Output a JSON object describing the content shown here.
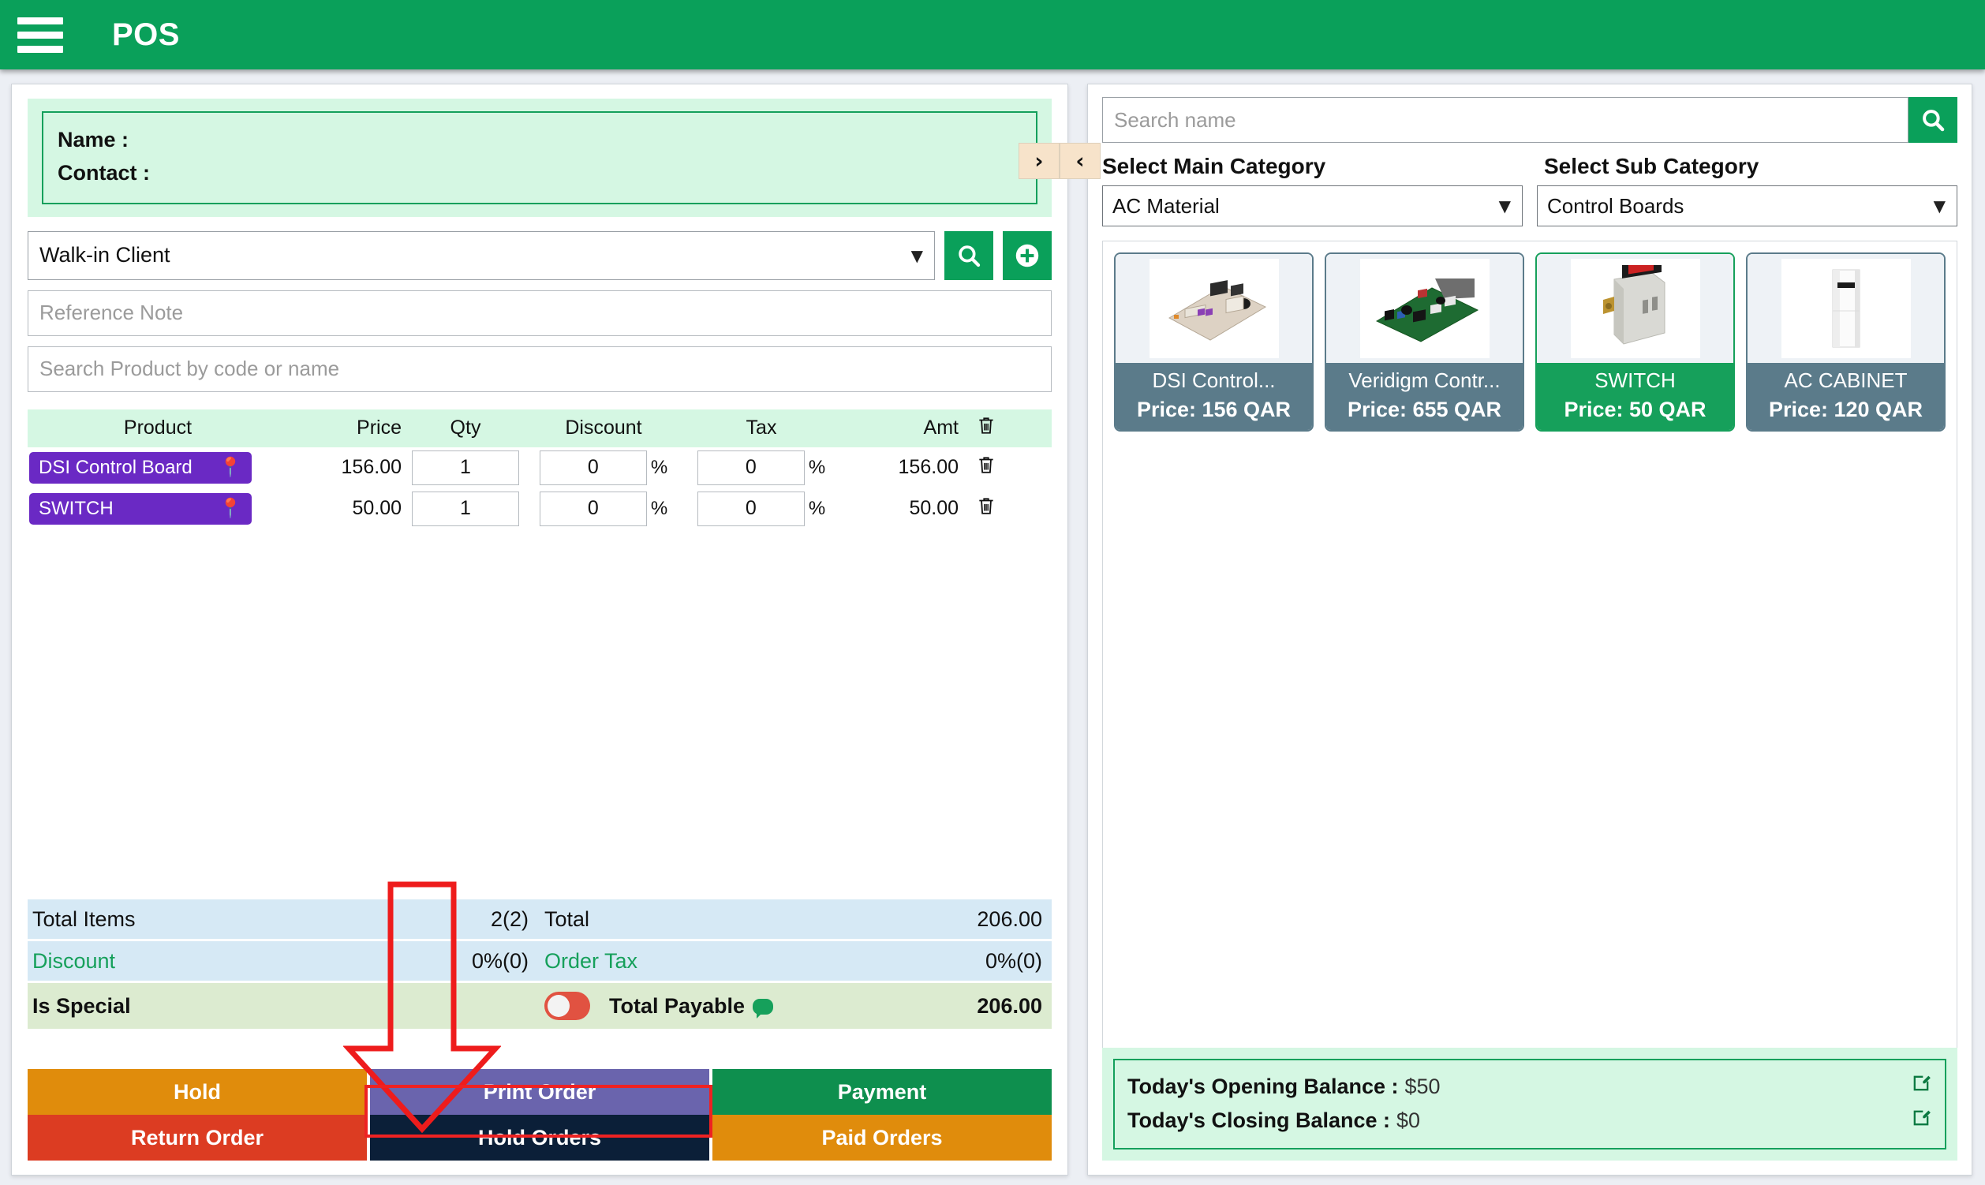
{
  "topbar": {
    "menu_icon": "hamburger-icon",
    "title": "POS"
  },
  "toggles": {
    "right": "›",
    "left": "‹"
  },
  "customer": {
    "name_label": "Name :",
    "contact_label": "Contact :"
  },
  "client": {
    "selected": "Walk-in Client",
    "caret": "▼",
    "search_icon": "search-icon",
    "add_icon": "plus-icon"
  },
  "inputs": {
    "reference_note_placeholder": "Reference Note",
    "product_search_placeholder": "Search Product by code or name"
  },
  "items_table": {
    "headers": [
      "Product",
      "Price",
      "Qty",
      "Discount",
      "Tax",
      "Amt"
    ],
    "delete_all_icon": "trash-icon",
    "percent_symbol": "%",
    "rows": [
      {
        "product": "DSI Control Board",
        "pin_icon": "location-pin-icon",
        "price": "156.00",
        "qty": "1",
        "discount": "0",
        "tax": "0",
        "amount": "156.00",
        "delete_icon": "trash-icon"
      },
      {
        "product": "SWITCH",
        "pin_icon": "location-pin-icon",
        "price": "50.00",
        "qty": "1",
        "discount": "0",
        "tax": "0",
        "amount": "50.00",
        "delete_icon": "trash-icon"
      }
    ]
  },
  "totals": {
    "total_items_label": "Total Items",
    "total_items_value": "2(2)",
    "total_label": "Total",
    "total_value": "206.00",
    "discount_label": "Discount",
    "discount_value": "0%(0)",
    "order_tax_label": "Order Tax",
    "order_tax_value": "0%(0)",
    "is_special_label": "Is Special",
    "total_payable_label": "Total Payable",
    "total_payable_value": "206.00"
  },
  "actions": {
    "hold": "Hold",
    "print_order": "Print Order",
    "payment": "Payment",
    "return_order": "Return Order",
    "hold_orders": "Hold Orders",
    "paid_orders": "Paid Orders"
  },
  "right": {
    "search_placeholder": "Search name",
    "search_icon": "search-icon",
    "main_category_label": "Select Main Category",
    "main_category_value": "AC Material",
    "sub_category_label": "Select Sub Category",
    "sub_category_value": "Control Boards",
    "caret": "▼",
    "price_prefix": "Price: ",
    "products": [
      {
        "name": "DSI Control...",
        "price": "156 QAR",
        "selected": false,
        "image": "circuit-board-image"
      },
      {
        "name": "Veridigm Contr...",
        "price": "655 QAR",
        "selected": false,
        "image": "green-circuit-board-image"
      },
      {
        "name": "SWITCH",
        "price": "50 QAR",
        "selected": true,
        "image": "power-switch-image"
      },
      {
        "name": "AC CABINET",
        "price": "120 QAR",
        "selected": false,
        "image": "ac-cabinet-image"
      }
    ]
  },
  "balance": {
    "opening_label": "Today's Opening Balance :",
    "opening_value": "$50",
    "closing_label": "Today's Closing Balance :",
    "closing_value": "$0",
    "edit_icon": "edit-icon"
  },
  "colors": {
    "brand_green": "#0aa05a",
    "badge_purple": "#6a29c4",
    "highlight_red": "#ee2222",
    "card_selected": "#16a05b",
    "card_unselected": "#5b7b8a"
  }
}
